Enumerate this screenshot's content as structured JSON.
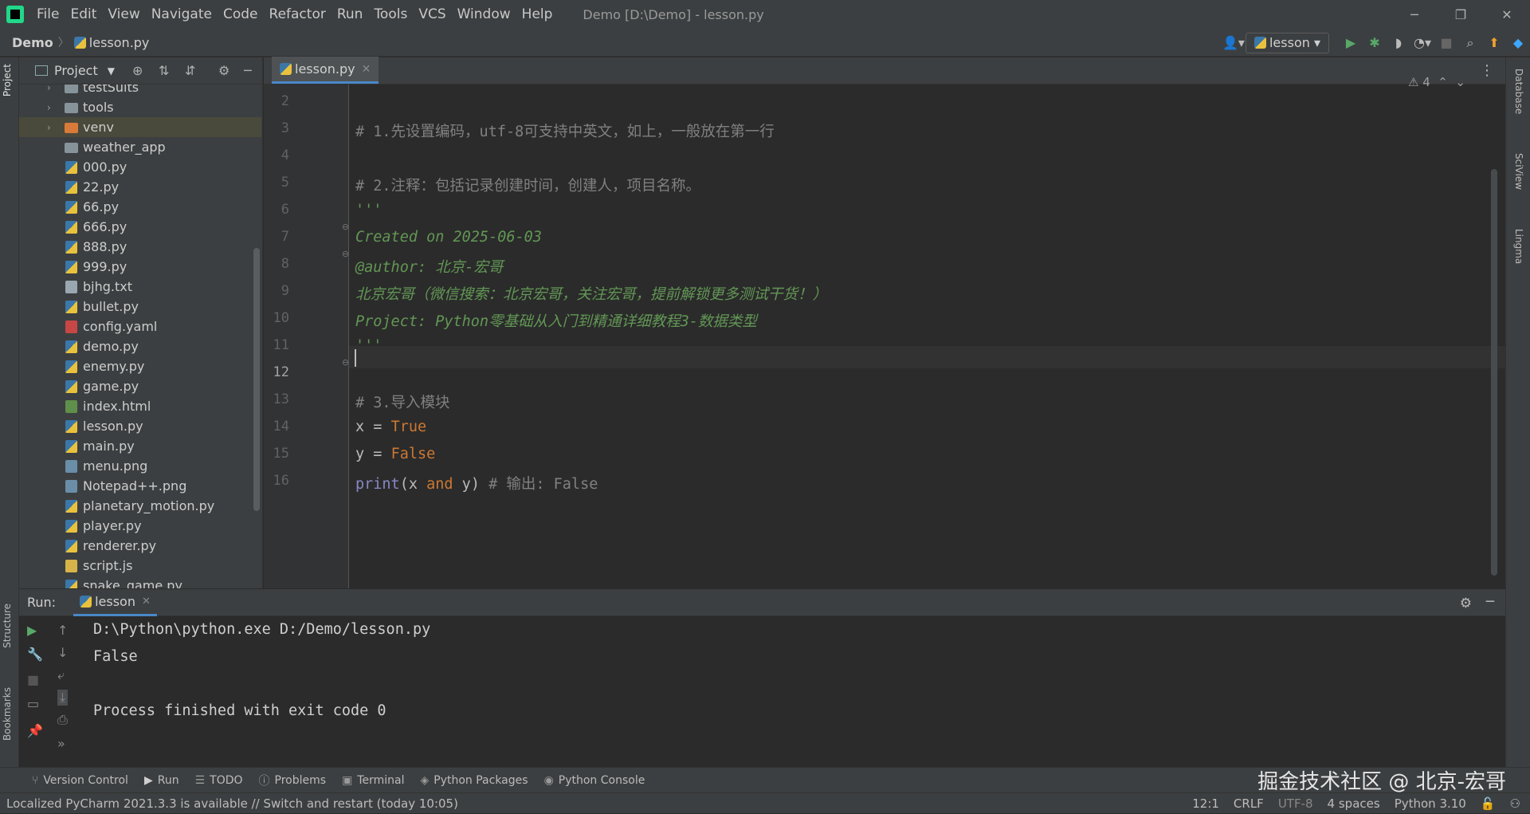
{
  "menubar": {
    "items": [
      "File",
      "Edit",
      "View",
      "Navigate",
      "Code",
      "Refactor",
      "Run",
      "Tools",
      "VCS",
      "Window",
      "Help"
    ],
    "window_title": "Demo [D:\\Demo] - lesson.py"
  },
  "navbar": {
    "project": "Demo",
    "file": "lesson.py",
    "run_config": "lesson"
  },
  "project_panel": {
    "title": "Project",
    "items": [
      {
        "label": "testSuits",
        "kind": "folder"
      },
      {
        "label": "tools",
        "kind": "folder"
      },
      {
        "label": "venv",
        "kind": "folder"
      },
      {
        "label": "weather_app",
        "kind": "folder"
      },
      {
        "label": "000.py",
        "kind": "py"
      },
      {
        "label": "22.py",
        "kind": "py"
      },
      {
        "label": "66.py",
        "kind": "py"
      },
      {
        "label": "666.py",
        "kind": "py"
      },
      {
        "label": "888.py",
        "kind": "py"
      },
      {
        "label": "999.py",
        "kind": "py"
      },
      {
        "label": "bjhg.txt",
        "kind": "txt"
      },
      {
        "label": "bullet.py",
        "kind": "py"
      },
      {
        "label": "config.yaml",
        "kind": "yaml"
      },
      {
        "label": "demo.py",
        "kind": "py"
      },
      {
        "label": "enemy.py",
        "kind": "py"
      },
      {
        "label": "game.py",
        "kind": "py"
      },
      {
        "label": "index.html",
        "kind": "html"
      },
      {
        "label": "lesson.py",
        "kind": "py"
      },
      {
        "label": "main.py",
        "kind": "py"
      },
      {
        "label": "menu.png",
        "kind": "png"
      },
      {
        "label": "Notepad++.png",
        "kind": "png"
      },
      {
        "label": "planetary_motion.py",
        "kind": "py"
      },
      {
        "label": "player.py",
        "kind": "py"
      },
      {
        "label": "renderer.py",
        "kind": "py"
      },
      {
        "label": "script.js",
        "kind": "js"
      },
      {
        "label": "snake_game.py",
        "kind": "py"
      }
    ]
  },
  "editor": {
    "tab": "lesson.py",
    "warnings": "4",
    "line_numbers": [
      "2",
      "3",
      "4",
      "5",
      "6",
      "7",
      "8",
      "9",
      "10",
      "11",
      "12",
      "13",
      "14",
      "15",
      "16"
    ],
    "lines": {
      "l3": "# 1.先设置编码，utf-8可支持中英文，如上，一般放在第一行",
      "l5": "# 2.注释：包括记录创建时间，创建人，项目名称。",
      "l6": "'''",
      "l7": "Created on 2025-06-03",
      "l8": "@author: 北京-宏哥",
      "l9": "北京宏哥（微信搜索：北京宏哥，关注宏哥，提前解锁更多测试干货！）",
      "l10": "Project: Python零基础从入门到精通详细教程3-数据类型",
      "l11": "'''",
      "l13": "# 3.导入模块",
      "l14_a": "x = ",
      "l14_b": "True",
      "l15_a": "y = ",
      "l15_b": "False",
      "l16_fn": "print",
      "l16_a": "(x ",
      "l16_kw": "and",
      "l16_b": " y) ",
      "l16_cmt": "# 输出: False"
    }
  },
  "run_panel": {
    "label": "Run:",
    "tab": "lesson",
    "output": [
      "D:\\Python\\python.exe D:/Demo/lesson.py",
      "False",
      "",
      "Process finished with exit code 0"
    ]
  },
  "bottom_tools": [
    "Version Control",
    "Run",
    "TODO",
    "Problems",
    "Terminal",
    "Python Packages",
    "Python Console"
  ],
  "statusbar": {
    "message": "Localized PyCharm 2021.3.3 is available // Switch and restart (today 10:05)",
    "position": "12:1",
    "line_sep": "CRLF",
    "encoding": "UTF-8",
    "indent": "4 spaces",
    "interpreter": "Python 3.10"
  },
  "side_tabs": {
    "left": [
      "Project",
      "Structure",
      "Bookmarks"
    ],
    "right": [
      "Database",
      "SciView",
      "Lingma"
    ]
  },
  "watermark": "掘金技术社区 @ 北京-宏哥"
}
